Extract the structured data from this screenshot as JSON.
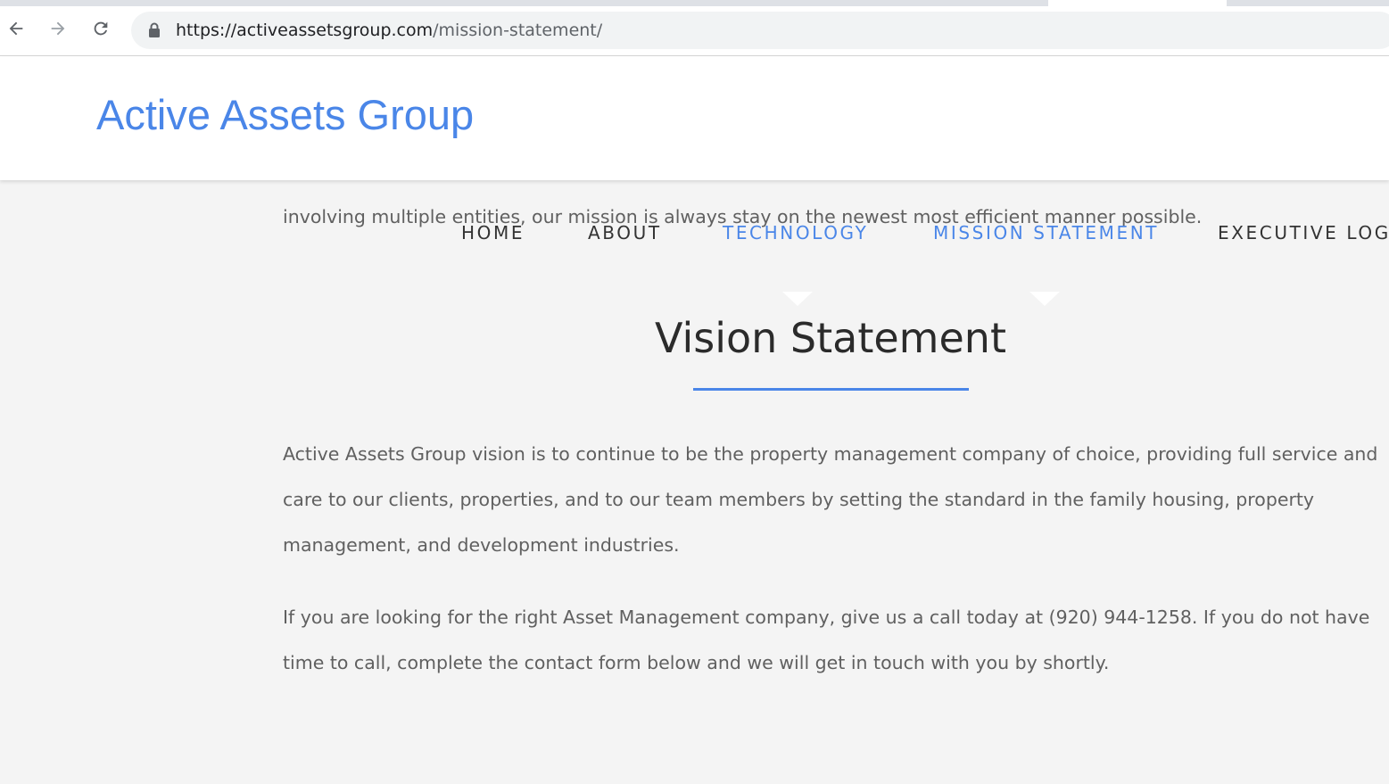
{
  "browser": {
    "url_host": "https://activeassetsgroup.com",
    "url_path": "/mission-statement/",
    "back_icon": "arrow-left-icon",
    "forward_icon": "arrow-right-icon",
    "reload_icon": "reload-icon",
    "lock_icon": "lock-icon"
  },
  "header": {
    "logo_text": "Active Assets Group",
    "logo_color": "#4a86e8"
  },
  "nav": {
    "items": [
      {
        "label": "HOME",
        "active": false
      },
      {
        "label": "ABOUT",
        "active": false
      },
      {
        "label": "TECHNOLOGY",
        "active": true
      },
      {
        "label": "MISSION STATEMENT",
        "active": true
      },
      {
        "label": "EXECUTIVE LOG",
        "active": false
      }
    ],
    "accent_color": "#4a86e8"
  },
  "content": {
    "scrolled_line_above": "involving multiple entities, our mission is always stay on the newest most efficient manner possible.",
    "section_title": "Vision Statement",
    "paragraph_1": "Active Assets Group vision is to continue to be the property management company of choice, providing full service and care to our clients, properties, and to our team members by setting the standard in the family housing, property management, and development industries.",
    "paragraph_2": "If you are looking for the right Asset Management company, give us a call today at (920) 944-1258.  If you do not have time to call, complete the contact form below and we will get in touch with you by shortly."
  }
}
